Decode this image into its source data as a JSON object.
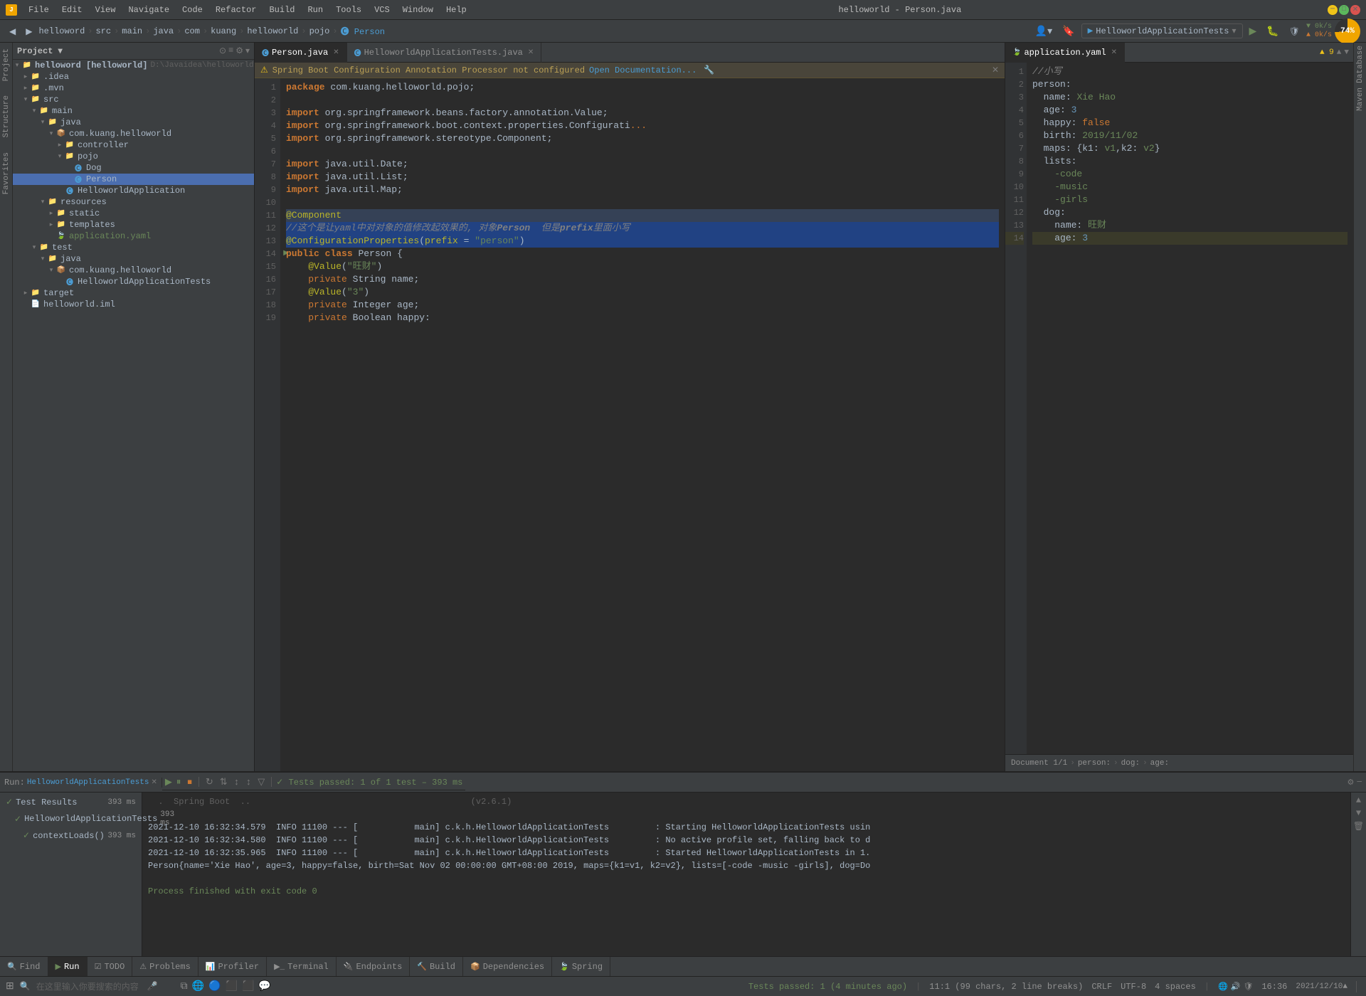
{
  "window": {
    "title": "helloworld - Person.java",
    "min_label": "─",
    "max_label": "□",
    "close_label": "✕"
  },
  "menu": {
    "items": [
      "File",
      "Edit",
      "View",
      "Navigate",
      "Code",
      "Refactor",
      "Build",
      "Run",
      "Tools",
      "VCS",
      "Window",
      "Help"
    ]
  },
  "toolbar": {
    "breadcrumb": [
      "helloword",
      "src",
      "main",
      "java",
      "com",
      "kuang",
      "helloworld",
      "pojo",
      "Person"
    ],
    "run_config": "HelloworldApplicationTests",
    "run_label": "▶",
    "build_label": "🔨",
    "settings_label": "⚙"
  },
  "project": {
    "title": "Project",
    "root": "helloword [helloworld]",
    "root_path": "D:\\Javaidea\\helloworld",
    "tree": [
      {
        "id": "helloword",
        "label": "helloword [helloworld]",
        "indent": 0,
        "type": "root",
        "expanded": true
      },
      {
        "id": "idea",
        "label": ".idea",
        "indent": 1,
        "type": "folder",
        "expanded": false
      },
      {
        "id": "mvn",
        "label": ".mvn",
        "indent": 1,
        "type": "folder",
        "expanded": false
      },
      {
        "id": "src",
        "label": "src",
        "indent": 1,
        "type": "folder",
        "expanded": true
      },
      {
        "id": "main",
        "label": "main",
        "indent": 2,
        "type": "folder",
        "expanded": true
      },
      {
        "id": "java",
        "label": "java",
        "indent": 3,
        "type": "folder",
        "expanded": true
      },
      {
        "id": "com.kuang.helloworld",
        "label": "com.kuang.helloworld",
        "indent": 4,
        "type": "package",
        "expanded": true
      },
      {
        "id": "controller",
        "label": "controller",
        "indent": 5,
        "type": "folder",
        "expanded": false
      },
      {
        "id": "pojo",
        "label": "pojo",
        "indent": 5,
        "type": "folder",
        "expanded": true
      },
      {
        "id": "Dog",
        "label": "Dog",
        "indent": 6,
        "type": "java",
        "expanded": false
      },
      {
        "id": "Person",
        "label": "Person",
        "indent": 6,
        "type": "java",
        "expanded": false,
        "selected": true
      },
      {
        "id": "HelloworldApplication",
        "label": "HelloworldApplication",
        "indent": 5,
        "type": "java",
        "expanded": false
      },
      {
        "id": "resources",
        "label": "resources",
        "indent": 3,
        "type": "folder",
        "expanded": true
      },
      {
        "id": "static",
        "label": "static",
        "indent": 4,
        "type": "folder",
        "expanded": false
      },
      {
        "id": "templates",
        "label": "templates",
        "indent": 4,
        "type": "folder",
        "expanded": false
      },
      {
        "id": "application.yaml",
        "label": "application.yaml",
        "indent": 4,
        "type": "yaml",
        "expanded": false
      },
      {
        "id": "test",
        "label": "test",
        "indent": 2,
        "type": "folder",
        "expanded": true
      },
      {
        "id": "test-java",
        "label": "java",
        "indent": 3,
        "type": "folder",
        "expanded": true
      },
      {
        "id": "test-com",
        "label": "com.kuang.helloworld",
        "indent": 4,
        "type": "package",
        "expanded": true
      },
      {
        "id": "HelloworldApplicationTests",
        "label": "HelloworldApplicationTests",
        "indent": 5,
        "type": "java",
        "expanded": false
      },
      {
        "id": "target",
        "label": "target",
        "indent": 1,
        "type": "folder",
        "expanded": false
      },
      {
        "id": "helloworld.iml",
        "label": "helloworld.iml",
        "indent": 1,
        "type": "iml",
        "expanded": false
      }
    ]
  },
  "editor": {
    "tabs": [
      {
        "label": "Person.java",
        "active": true,
        "type": "java"
      },
      {
        "label": "HelloworldApplicationTests.java",
        "active": false,
        "type": "java"
      },
      {
        "label": "application.yaml",
        "active": false,
        "type": "yaml"
      }
    ],
    "warning": "Spring Boot Configuration Annotation Processor not configured",
    "warning_link": "Open Documentation...",
    "lines": [
      {
        "num": 1,
        "text": "package com.kuang.helloworld.pojo;",
        "tokens": [
          {
            "t": "kw",
            "v": "package"
          },
          {
            "t": "pkg",
            "v": " com.kuang.helloworld.pojo;"
          }
        ]
      },
      {
        "num": 2,
        "text": ""
      },
      {
        "num": 3,
        "text": "import org.springframework.beans.factory.annotation.Value;",
        "tokens": [
          {
            "t": "kw",
            "v": "import"
          },
          {
            "t": "",
            "v": " org.springframework.beans.factory.annotation."
          },
          {
            "t": "cls",
            "v": "Value"
          },
          {
            "t": "",
            "v": ";"
          }
        ]
      },
      {
        "num": 4,
        "text": "import org.springframework.boot.context.properties.Configurati...",
        "tokens": [
          {
            "t": "kw",
            "v": "import"
          },
          {
            "t": "",
            "v": " org.springframework.boot.context.properties.Configurati..."
          }
        ]
      },
      {
        "num": 5,
        "text": "import org.springframework.stereotype.Component;",
        "tokens": [
          {
            "t": "kw",
            "v": "import"
          },
          {
            "t": "",
            "v": " org.springframework.stereotype."
          },
          {
            "t": "cls",
            "v": "Component"
          },
          {
            "t": "",
            "v": ";"
          }
        ]
      },
      {
        "num": 6,
        "text": ""
      },
      {
        "num": 7,
        "text": "import java.util.Date;",
        "tokens": [
          {
            "t": "kw",
            "v": "import"
          },
          {
            "t": "",
            "v": " java.util."
          },
          {
            "t": "cls",
            "v": "Date"
          },
          {
            "t": "",
            "v": ";"
          }
        ]
      },
      {
        "num": 8,
        "text": "import java.util.List;",
        "tokens": [
          {
            "t": "kw",
            "v": "import"
          },
          {
            "t": "",
            "v": " java.util."
          },
          {
            "t": "cls",
            "v": "List"
          },
          {
            "t": "",
            "v": ";"
          }
        ]
      },
      {
        "num": 9,
        "text": "import java.util.Map;",
        "tokens": [
          {
            "t": "kw",
            "v": "import"
          },
          {
            "t": "",
            "v": " java.util."
          },
          {
            "t": "cls",
            "v": "Map"
          },
          {
            "t": "",
            "v": ";"
          }
        ]
      },
      {
        "num": 10,
        "text": ""
      },
      {
        "num": 11,
        "text": "@Component",
        "tokens": [
          {
            "t": "ann",
            "v": "@Component"
          }
        ],
        "highlight": true
      },
      {
        "num": 12,
        "text": "//这个是让yaml中对对象的值修改起效果的, 对象Person  但是prefix里面小写",
        "tokens": [
          {
            "t": "cmt",
            "v": "//这个是让yaml中对对象的值修改起效果的, 对象"
          },
          {
            "t": "cmt bold",
            "v": "Person"
          },
          {
            "t": "cmt",
            "v": "  但是"
          },
          {
            "t": "cmt bold",
            "v": "prefix"
          },
          {
            "t": "cmt",
            "v": "里面小写"
          }
        ],
        "highlight": true
      },
      {
        "num": 13,
        "text": "@ConfigurationProperties(prefix = \"person\")",
        "tokens": [
          {
            "t": "ann",
            "v": "@ConfigurationProperties"
          },
          {
            "t": "",
            "v": "("
          },
          {
            "t": "ann",
            "v": "prefix"
          },
          {
            "t": "",
            "v": " = "
          },
          {
            "t": "str",
            "v": "\"person\""
          },
          {
            "t": "",
            "v": ")"
          }
        ],
        "highlight": true
      },
      {
        "num": 14,
        "text": "public class Person {",
        "tokens": [
          {
            "t": "kw",
            "v": "public"
          },
          {
            "t": "",
            "v": " "
          },
          {
            "t": "kw",
            "v": "class"
          },
          {
            "t": "",
            "v": " "
          },
          {
            "t": "cls",
            "v": "Person"
          },
          {
            "t": "",
            "v": " {"
          }
        ]
      },
      {
        "num": 15,
        "text": "    @Value(\"旺财\")",
        "tokens": [
          {
            "t": "",
            "v": "    "
          },
          {
            "t": "ann",
            "v": "@Value"
          },
          {
            "t": "",
            "v": "("
          },
          {
            "t": "str",
            "v": "\"旺财\""
          },
          {
            "t": "",
            "v": ")"
          }
        ]
      },
      {
        "num": 16,
        "text": "    private String name;",
        "tokens": [
          {
            "t": "",
            "v": "    "
          },
          {
            "t": "kw2",
            "v": "private"
          },
          {
            "t": "",
            "v": " "
          },
          {
            "t": "cls",
            "v": "String"
          },
          {
            "t": "",
            "v": " name;"
          }
        ]
      },
      {
        "num": 17,
        "text": "    @Value(\"3\")",
        "tokens": [
          {
            "t": "",
            "v": "    "
          },
          {
            "t": "ann",
            "v": "@Value"
          },
          {
            "t": "",
            "v": "("
          },
          {
            "t": "str",
            "v": "\"3\""
          },
          {
            "t": "",
            "v": ")"
          }
        ]
      },
      {
        "num": 18,
        "text": "    private Integer age;",
        "tokens": [
          {
            "t": "",
            "v": "    "
          },
          {
            "t": "kw2",
            "v": "private"
          },
          {
            "t": "",
            "v": " "
          },
          {
            "t": "cls",
            "v": "Integer"
          },
          {
            "t": "",
            "v": " age;"
          }
        ]
      },
      {
        "num": 19,
        "text": "    private Boolean happy:",
        "tokens": [
          {
            "t": "",
            "v": "    "
          },
          {
            "t": "kw2",
            "v": "private"
          },
          {
            "t": "",
            "v": " "
          },
          {
            "t": "cls",
            "v": "Boolean"
          },
          {
            "t": "",
            "v": " happy:"
          }
        ]
      }
    ]
  },
  "yaml_editor": {
    "tabs": [
      {
        "label": "application.yaml",
        "active": true
      }
    ],
    "lines": [
      {
        "num": 1,
        "text": "//小写"
      },
      {
        "num": 2,
        "text": "person:"
      },
      {
        "num": 3,
        "text": "  name: Xie Hao"
      },
      {
        "num": 4,
        "text": "  age: 3"
      },
      {
        "num": 5,
        "text": "  happy: false"
      },
      {
        "num": 6,
        "text": "  birth: 2019/11/02"
      },
      {
        "num": 7,
        "text": "  maps: {k1: v1,k2: v2}"
      },
      {
        "num": 8,
        "text": "  lists:"
      },
      {
        "num": 9,
        "text": "    -code"
      },
      {
        "num": 10,
        "text": "    -music"
      },
      {
        "num": 11,
        "text": "    -girls"
      },
      {
        "num": 12,
        "text": "  dog:"
      },
      {
        "num": 13,
        "text": "    name: 旺财"
      },
      {
        "num": 14,
        "text": "    age: 3"
      }
    ],
    "breadcrumb": [
      "Document 1/1",
      "person:",
      "dog:",
      "age:"
    ]
  },
  "run_panel": {
    "tab_label": "Run:",
    "config_label": "HelloworldApplicationTests",
    "test_result": "Tests passed: 1 of 1 test – 393 ms",
    "tree": [
      {
        "label": "Test Results",
        "time": "393 ms",
        "type": "pass",
        "indent": 0
      },
      {
        "label": "HelloworldApplicationTests",
        "time": "393 ms",
        "type": "pass",
        "indent": 1
      },
      {
        "label": "contextLoads()",
        "time": "393 ms",
        "type": "pass",
        "indent": 2
      }
    ],
    "log_lines": [
      {
        "text": ".  Spring Boot  ..                                           (v2.6.1)",
        "type": "normal"
      },
      {
        "text": ""
      },
      {
        "text": "2021-12-10 16:32:34.579  INFO 11100 --- [           main] c.k.h.HelloworldApplicationTests         : Starting HelloworldApplicationTests usin"
      },
      {
        "text": "2021-12-10 16:32:34.580  INFO 11100 --- [           main] c.k.h.HelloworldApplicationTests         : No active profile set, falling back to d"
      },
      {
        "text": "2021-12-10 16:32:35.965  INFO 11100 --- [           main] c.k.h.HelloworldApplicationTests         : Started HelloworldApplicationTests in 1."
      },
      {
        "text": "Person{name='Xie Hao', age=3, happy=false, birth=Sat Nov 02 00:00:00 GMT+08:00 2019, maps={k1=v1, k2=v2}, lists=[-code -music -girls], dog=Do"
      },
      {
        "text": ""
      },
      {
        "text": "Process finished with exit code 0",
        "type": "green"
      }
    ]
  },
  "bottom_bar": {
    "tabs": [
      "Find",
      "Run",
      "TODO",
      "Problems",
      "Profiler",
      "Terminal",
      "Endpoints",
      "Build",
      "Dependencies",
      "Spring"
    ],
    "active_tab": "Run"
  },
  "status_bar": {
    "left": "Tests passed: 1 (4 minutes ago)",
    "position": "11:1 (99 chars, 2 line breaks)",
    "line_sep": "CRLF",
    "encoding": "UTF-8",
    "indent": "4 spaces",
    "right_time": "16:36",
    "right_date": "2021/12/10▲"
  },
  "cpu": {
    "value": "74%",
    "net_down": "0k/s",
    "net_up": "0k/s"
  }
}
